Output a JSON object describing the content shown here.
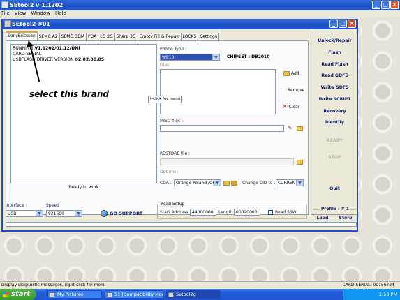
{
  "app": {
    "title": "SEtool2 v 1.1202",
    "menu": [
      "File",
      "View",
      "Window",
      "Help"
    ]
  },
  "inner_window": {
    "title": "SEtool2 #01",
    "tabs": [
      "SonyEricsson",
      "SEMC A2",
      "SEMC ODM",
      "PDA",
      "LG 3G",
      "Sharp 3G",
      "Empty Fill & Repair",
      "LOCKS",
      "Settings"
    ],
    "active_tab": "SonyEricsson"
  },
  "log": {
    "lines": [
      {
        "pre": "RUNNING ",
        "bold": "V1.1202/01.12/UNI"
      },
      {
        "pre": "CARD SERIAL",
        "bold": ""
      },
      {
        "pre": "USBFLASH DRIVER VERSION ",
        "bold": "02.02.00.05"
      }
    ],
    "status": "Ready to work"
  },
  "phone": {
    "type_label": "Phone Type :",
    "type_value": "W810",
    "chipset": "CHIPSET : DB2010",
    "files_label": "Files",
    "add": "Add",
    "remove": "Remove",
    "clear": "Clear",
    "context_hint": "t-click for menu",
    "misc_label": "MISC files :",
    "restore_label": "RESTORE file :",
    "options_label": "Options :",
    "cda_label": "CDA :",
    "cda_value": "Orange Poland  /OR/",
    "change_cid_label": "Change CID to :",
    "change_cid_value": "CURRENT"
  },
  "annotation": "select this brand",
  "right_panel": {
    "buttons": [
      "Unlock/Repair",
      "Flash",
      "Read Flash",
      "Read GDFS",
      "Write GDFS",
      "Write SCRIPT",
      "Recovery",
      "Identify"
    ],
    "ready": "READY",
    "stop": "STOP",
    "quit": "Quit",
    "profile": "Profile : # 1",
    "load": "Load",
    "store": "Store"
  },
  "bottom": {
    "interface_label": "Interface :",
    "interface_value": "USB",
    "speed_label": "Speed :",
    "speed_value": "921600",
    "go_support": "GO SUPPORT",
    "read_setup": "Read Setup",
    "start_address_label": "Start Address :",
    "start_address_value": "44000000",
    "length_label": "Length :",
    "length_value": "00020000",
    "read_ssw": "Read SSW"
  },
  "status_bar": {
    "left": "Display diagnostic messages, right-click for menu",
    "right": "CARD SERIAL: 00156724"
  },
  "taskbar": {
    "start": "start",
    "tasks": [
      "My Pictures",
      "51 [Compatibility Mod...",
      "Setool2g"
    ],
    "clock": "3:53 PM"
  }
}
